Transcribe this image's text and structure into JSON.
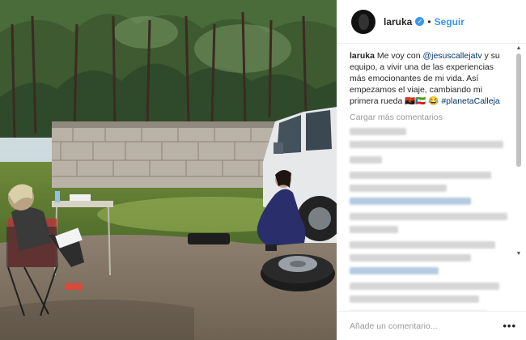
{
  "post": {
    "username": "laruka",
    "verified_icon": "verified-badge-icon",
    "separator": "•",
    "follow_label": "Seguir",
    "caption": {
      "user": "laruka",
      "text_before": " Me voy con ",
      "mention": "@jesuscallejatv",
      "text_after": " y su equipo, a vivir una de las experiencias más emocionantes de mi vida. Así empezamos el viaje, cambiando mi primera rueda 🇦🇴🇬🇶 😂 ",
      "hashtag": "#planetaCalleja"
    },
    "load_more": "Cargar más comentarios",
    "comment_placeholder": "Añade un comentario...",
    "more_label": "•••"
  },
  "colors": {
    "accent": "#3897f0",
    "link": "#003569",
    "text": "#262626",
    "muted": "#999999"
  }
}
